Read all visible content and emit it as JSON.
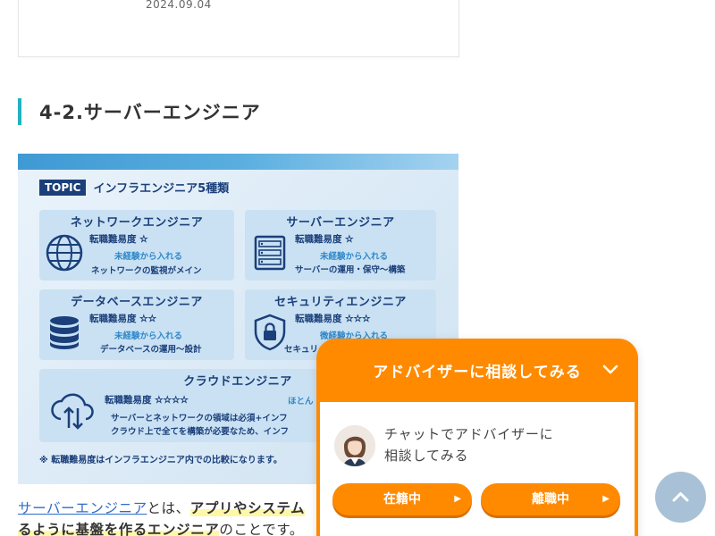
{
  "previous_card": {
    "date": "2024.09.04"
  },
  "section_heading": "4-2.サーバーエンジニア",
  "infographic": {
    "topic_badge": "TOPIC",
    "topic_title": "インフラエンジニア5種類",
    "difficulty_label": "転職難易度",
    "boxes": [
      {
        "title": "ネットワークエンジニア",
        "stars": "☆",
        "experience": "未経験から入れる",
        "desc": "ネットワークの監視がメイン",
        "icon": "globe-icon"
      },
      {
        "title": "サーバーエンジニア",
        "stars": "☆",
        "experience": "未経験から入れる",
        "desc": "サーバーの運用・保守〜構築",
        "icon": "server-icon"
      },
      {
        "title": "データベースエンジニア",
        "stars": "☆☆",
        "experience": "未経験から入れる",
        "desc": "データベースの運用〜設計",
        "icon": "database-icon"
      },
      {
        "title": "セキュリティエンジニア",
        "stars": "☆☆☆",
        "experience": "微経験から入れる",
        "desc": "セキュリ",
        "icon": "shield-lock-icon"
      },
      {
        "title": "クラウドエンジニア",
        "stars": "☆☆☆☆",
        "experience": "ほとん",
        "desc": "サーバーとネットワークの領域は必須+インフ",
        "desc2": "クラウド上で全てを構築が必要なため、インフ",
        "icon": "cloud-icon"
      }
    ],
    "note": "※ 転職難易度はインフラエンジニア内での比較になります。"
  },
  "paragraph": {
    "link_text": "サーバーエンジニア",
    "text_after_link": "とは、",
    "highlight_1": "アプリやシステム",
    "highlight_2": "るように基盤を作るエンジニア",
    "text_end": "のことです。"
  },
  "chat_widget": {
    "title": "アドバイザーに相談してみる",
    "message_line1": "チャットでアドバイザーに",
    "message_line2": "相談してみる",
    "button_employed": "在籍中",
    "button_left": "離職中",
    "accent_color": "#ff8a00"
  },
  "back_to_top": {
    "icon": "chevron-up-icon"
  }
}
